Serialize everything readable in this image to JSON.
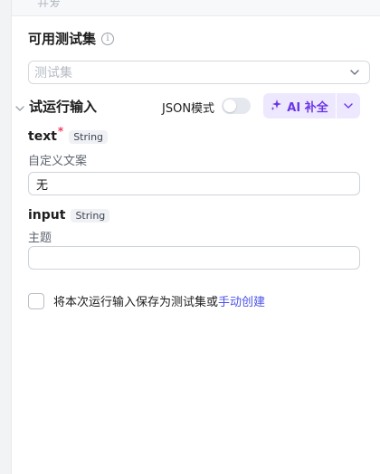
{
  "top_strip": {
    "hint": "开发"
  },
  "testset": {
    "title": "可用测试集",
    "placeholder": "测试集"
  },
  "run_input": {
    "title": "试运行输入",
    "json_mode_label": "JSON模式",
    "json_mode_on": false,
    "ai_button_label": "AI 补全"
  },
  "fields": [
    {
      "name": "text",
      "required": true,
      "type": "String",
      "description": "自定义文案",
      "value": "无"
    },
    {
      "name": "input",
      "required": false,
      "type": "String",
      "description": "主题",
      "value": ""
    }
  ],
  "save": {
    "text": "将本次运行输入保存为测试集或",
    "link": "手动创建",
    "checked": false
  },
  "colors": {
    "accent": "#6a37e6",
    "link": "#4d53e8",
    "required": "#f5385c"
  }
}
